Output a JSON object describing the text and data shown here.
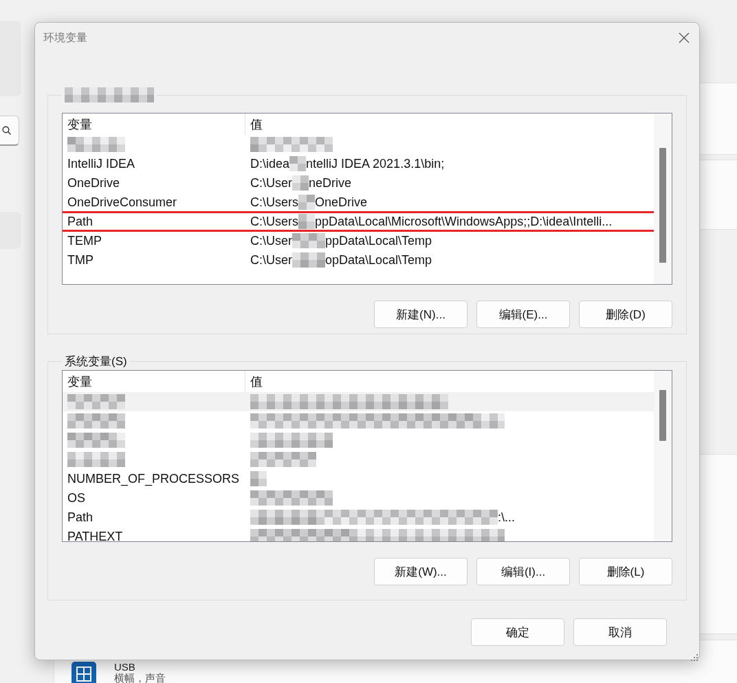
{
  "window": {
    "title": "环境变量"
  },
  "user_variables": {
    "legend": [
      {
        "kind": "mosaic"
      }
    ],
    "columns": [
      "变量",
      "值"
    ],
    "rows": [
      {
        "name": [
          {
            "kind": "mosaic"
          }
        ],
        "value": [
          {
            "kind": "mosaic"
          }
        ],
        "selected": false,
        "outlined": false
      },
      {
        "name": [
          {
            "kind": "text",
            "text": "IntelliJ IDEA"
          }
        ],
        "value": [
          {
            "kind": "text",
            "text": "D:\\idea"
          },
          {
            "kind": "mosaic"
          },
          {
            "kind": "text",
            "text": "ntelliJ IDEA 2021.3.1\\bin;"
          }
        ],
        "selected": false,
        "outlined": false
      },
      {
        "name": [
          {
            "kind": "text",
            "text": "OneDrive"
          }
        ],
        "value": [
          {
            "kind": "text",
            "text": "C:\\User"
          },
          {
            "kind": "mosaic"
          },
          {
            "kind": "text",
            "text": "neDrive"
          }
        ],
        "selected": false,
        "outlined": false
      },
      {
        "name": [
          {
            "kind": "text",
            "text": "OneDriveConsumer"
          }
        ],
        "value": [
          {
            "kind": "text",
            "text": "C:\\Users"
          },
          {
            "kind": "mosaic"
          },
          {
            "kind": "text",
            "text": "OneDrive"
          }
        ],
        "selected": false,
        "outlined": false
      },
      {
        "name": [
          {
            "kind": "text",
            "text": "Path"
          }
        ],
        "value": [
          {
            "kind": "text",
            "text": "C:\\Users"
          },
          {
            "kind": "mosaic"
          },
          {
            "kind": "text",
            "text": "ppData\\Local\\Microsoft\\WindowsApps;;D:\\idea\\Intelli..."
          }
        ],
        "selected": false,
        "outlined": true
      },
      {
        "name": [
          {
            "kind": "text",
            "text": "TEMP"
          }
        ],
        "value": [
          {
            "kind": "text",
            "text": "C:\\User"
          },
          {
            "kind": "mosaic"
          },
          {
            "kind": "text",
            "text": "ppData\\Local\\Temp"
          }
        ],
        "selected": false,
        "outlined": false
      },
      {
        "name": [
          {
            "kind": "text",
            "text": "TMP"
          }
        ],
        "value": [
          {
            "kind": "text",
            "text": "C:\\User"
          },
          {
            "kind": "mosaic"
          },
          {
            "kind": "text",
            "text": "opData\\Local\\Temp"
          }
        ],
        "selected": false,
        "outlined": false
      }
    ],
    "buttons": [
      "新建(N)...",
      "编辑(E)...",
      "删除(D)"
    ]
  },
  "system_variables": {
    "legend": [
      {
        "kind": "text",
        "text": "系统变量(S)"
      }
    ],
    "columns": [
      "变量",
      "值"
    ],
    "rows": [
      {
        "name": [
          {
            "kind": "mosaic"
          }
        ],
        "value": [
          {
            "kind": "mosaic"
          }
        ],
        "selected": true,
        "outlined": false
      },
      {
        "name": [
          {
            "kind": "mosaic"
          }
        ],
        "value": [
          {
            "kind": "mosaic"
          }
        ],
        "selected": false,
        "outlined": false
      },
      {
        "name": [
          {
            "kind": "mosaic"
          }
        ],
        "value": [
          {
            "kind": "mosaic"
          }
        ],
        "selected": false,
        "outlined": false
      },
      {
        "name": [
          {
            "kind": "mosaic"
          }
        ],
        "value": [
          {
            "kind": "mosaic"
          }
        ],
        "selected": false,
        "outlined": false
      },
      {
        "name": [
          {
            "kind": "text",
            "text": "NUMBER_OF_PROCESSORS"
          }
        ],
        "value": [
          {
            "kind": "mosaic"
          }
        ],
        "selected": false,
        "outlined": false
      },
      {
        "name": [
          {
            "kind": "text",
            "text": "OS"
          }
        ],
        "value": [
          {
            "kind": "mosaic"
          }
        ],
        "selected": false,
        "outlined": false
      },
      {
        "name": [
          {
            "kind": "text",
            "text": "Path"
          }
        ],
        "value": [
          {
            "kind": "mosaic"
          },
          {
            "kind": "text",
            "text": ":\\..."
          }
        ],
        "selected": false,
        "outlined": false
      },
      {
        "name": [
          {
            "kind": "text",
            "text": "PATHEXT"
          }
        ],
        "value": [
          {
            "kind": "mosaic"
          }
        ],
        "selected": false,
        "outlined": false
      }
    ],
    "buttons": [
      "新建(W)...",
      "编辑(I)...",
      "删除(L)"
    ]
  },
  "dialog_buttons": [
    "确定",
    "取消"
  ],
  "background": {
    "list_item": {
      "title": "USB",
      "subtitle": "横幅，声音"
    }
  }
}
